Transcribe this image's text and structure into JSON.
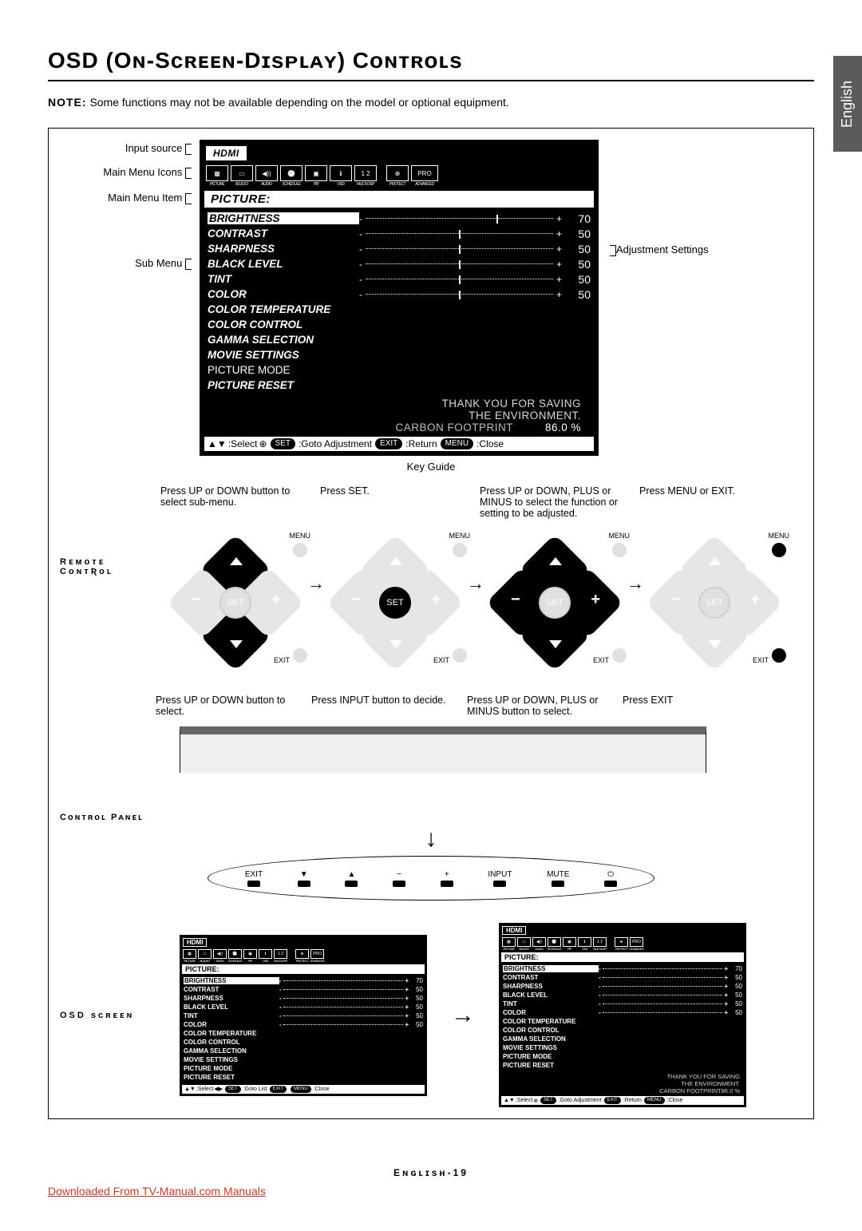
{
  "lang_tab": "English",
  "title": "OSD (Oɴ-Sᴄʀᴇᴇɴ-Dɪsᴘʟᴀʏ) Cᴏɴᴛʀᴏʟs",
  "note_label": "NOTE:",
  "note_text": "Some functions may not be available depending on the model or optional equipment.",
  "labels": {
    "input_source": "Input source",
    "main_menu_icons": "Main Menu Icons",
    "main_menu_item": "Main Menu Item",
    "sub_menu": "Sub Menu",
    "adjustment_settings": "Adjustment Settings",
    "key_guide": "Key Guide",
    "remote_control": "Rᴇᴍᴏᴛᴇ Cᴏɴᴛʀᴏʟ",
    "control_panel": "Cᴏɴᴛʀᴏʟ Pᴀɴᴇʟ",
    "osd_screen": "OSD sᴄʀᴇᴇɴ"
  },
  "osd": {
    "input": "HDMI",
    "icons": [
      {
        "glyph": "▦",
        "sub": "PICTURE"
      },
      {
        "glyph": "▭",
        "sub": "ADJUST"
      },
      {
        "glyph": "◀))",
        "sub": "AUDIO"
      },
      {
        "glyph": "🕘",
        "sub": "SCHEDULE"
      },
      {
        "glyph": "▣",
        "sub": "PIP"
      },
      {
        "glyph": "ℹ",
        "sub": "OSD"
      },
      {
        "glyph": "1 2",
        "sub": "MULTI-DSP"
      },
      {
        "glyph": "⊕",
        "sub": "PROTECT"
      },
      {
        "glyph": "PRO",
        "sub": "ADVANCED"
      }
    ],
    "section": "PICTURE:",
    "items": [
      {
        "label": "BRIGHTNESS",
        "val": "70",
        "slider": true,
        "sel": true,
        "tick": 70
      },
      {
        "label": "CONTRAST",
        "val": "50",
        "slider": true,
        "tick": 50
      },
      {
        "label": "SHARPNESS",
        "val": "50",
        "slider": true,
        "tick": 50
      },
      {
        "label": "BLACK LEVEL",
        "val": "50",
        "slider": true,
        "tick": 50
      },
      {
        "label": "TINT",
        "val": "50",
        "slider": true,
        "tick": 50
      },
      {
        "label": "COLOR",
        "val": "50",
        "slider": true,
        "tick": 50
      },
      {
        "label": "COLOR TEMPERATURE"
      },
      {
        "label": "COLOR CONTROL"
      },
      {
        "label": "GAMMA SELECTION"
      },
      {
        "label": "MOVIE SETTINGS"
      },
      {
        "label": "PICTURE MODE",
        "nonbold": true
      },
      {
        "label": "PICTURE RESET"
      }
    ],
    "eco": {
      "l1": "THANK YOU FOR SAVING",
      "l2": "THE ENVIRONMENT.",
      "l3": "CARBON FOOTPRINT",
      "pct": "86.0 %"
    },
    "keyguide_big": [
      {
        "t": "arrow",
        "v": "▲▼"
      },
      {
        "t": "txt",
        "v": ":Select"
      },
      {
        "t": "arrow",
        "v": "⊕"
      },
      {
        "t": "pill",
        "v": "SET"
      },
      {
        "t": "txt",
        "v": ":Goto Adjustment"
      },
      {
        "t": "pill",
        "v": "EXIT"
      },
      {
        "t": "txt",
        "v": ":Return"
      },
      {
        "t": "pill",
        "v": "MENU"
      },
      {
        "t": "txt",
        "v": ":Close"
      }
    ],
    "keyguide_small_left": [
      {
        "t": "arrow",
        "v": "▲▼"
      },
      {
        "t": "txt",
        "v": ":Select"
      },
      {
        "t": "arrow",
        "v": "◀▶"
      },
      {
        "t": "pill",
        "v": "SET"
      },
      {
        "t": "txt",
        "v": ":Goto List"
      },
      {
        "t": "pill",
        "v": "EXIT"
      },
      {
        "t": "pill",
        "v": "MENU"
      },
      {
        "t": "txt",
        "v": ":Close"
      }
    ]
  },
  "remote_steps": [
    {
      "cap": "Press UP or DOWN button to select sub-menu.",
      "up": true,
      "down": true
    },
    {
      "cap": "Press SET.",
      "center": true
    },
    {
      "cap": "Press UP or DOWN, PLUS or MINUS to select the function or setting to be adjusted.",
      "up": true,
      "down": true,
      "left": true,
      "right": true
    },
    {
      "cap": "Press MENU or EXIT.",
      "menu": true,
      "exit": true
    }
  ],
  "remote_btn_labels": {
    "menu": "MENU",
    "exit": "EXIT",
    "set": "SET"
  },
  "cp_steps": [
    {
      "cap": "Press UP or DOWN button to select."
    },
    {
      "cap": "Press INPUT button to decide."
    },
    {
      "cap": "Press UP or DOWN, PLUS or MINUS button to select."
    },
    {
      "cap": "Press EXIT"
    }
  ],
  "panel_buttons": [
    "EXIT",
    "▼",
    "▲",
    "−",
    "+",
    "INPUT",
    "MUTE",
    "⏻"
  ],
  "footer": "Eɴɢʟɪsʜ-19",
  "download_link": "Downloaded From TV-Manual.com Manuals"
}
